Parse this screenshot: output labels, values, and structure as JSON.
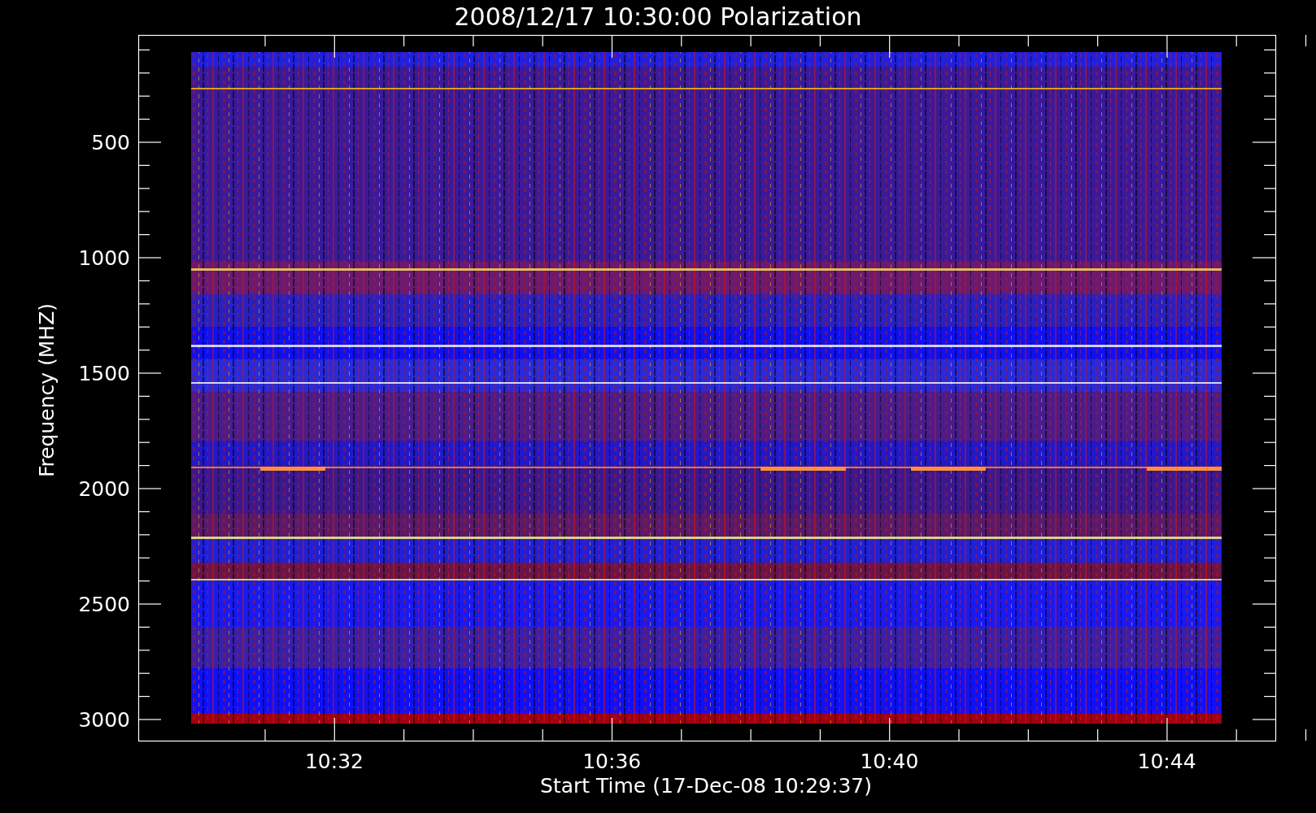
{
  "title": "2008/12/17 10:30:00 Polarization",
  "y_axis": {
    "label": "Frequency (MHZ)",
    "ticks": [
      "500",
      "1000",
      "1500",
      "2000",
      "2500",
      "3000"
    ]
  },
  "x_axis": {
    "label": "Start Time (17-Dec-08 10:29:37)",
    "ticks": [
      "10:32",
      "10:36",
      "10:40",
      "10:44"
    ]
  }
}
